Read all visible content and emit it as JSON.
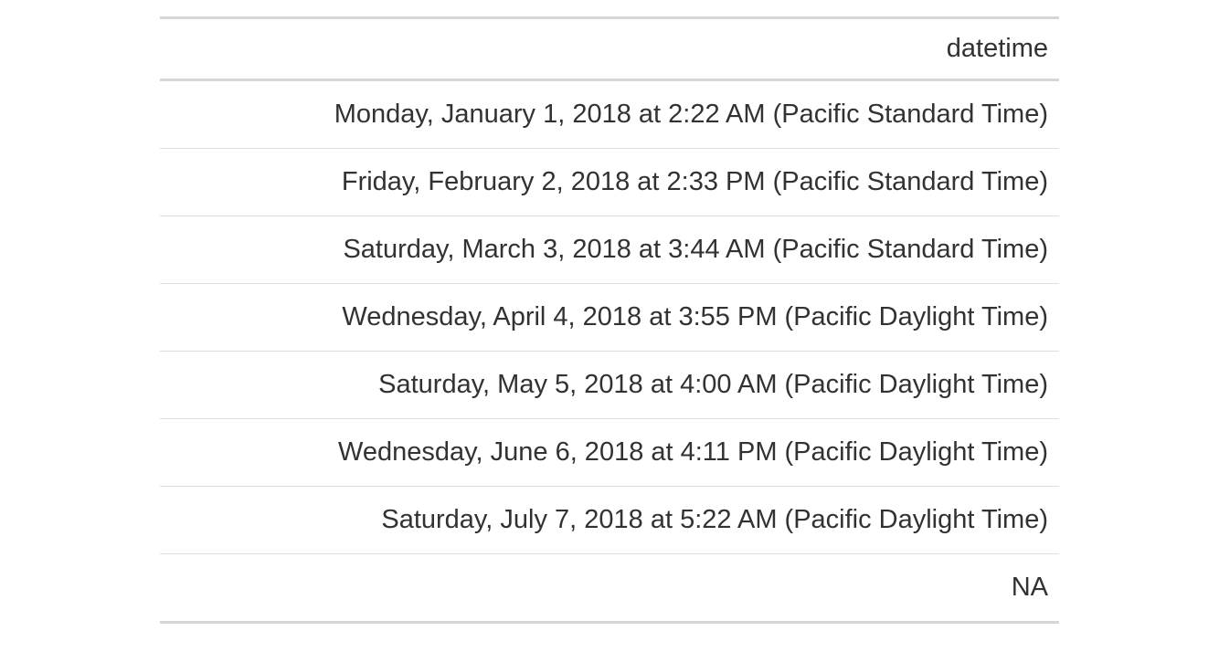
{
  "table": {
    "columns": [
      "datetime"
    ],
    "rows": [
      {
        "value": "Monday, January 1, 2018 at 2:22 AM (Pacific Standard Time)"
      },
      {
        "value": "Friday, February 2, 2018 at 2:33 PM (Pacific Standard Time)"
      },
      {
        "value": "Saturday, March 3, 2018 at 3:44 AM (Pacific Standard Time)"
      },
      {
        "value": "Wednesday, April 4, 2018 at 3:55 PM (Pacific Daylight Time)"
      },
      {
        "value": "Saturday, May 5, 2018 at 4:00 AM (Pacific Daylight Time)"
      },
      {
        "value": "Wednesday, June 6, 2018 at 4:11 PM (Pacific Daylight Time)"
      },
      {
        "value": "Saturday, July 7, 2018 at 5:22 AM (Pacific Daylight Time)"
      },
      {
        "value": "NA"
      }
    ]
  }
}
